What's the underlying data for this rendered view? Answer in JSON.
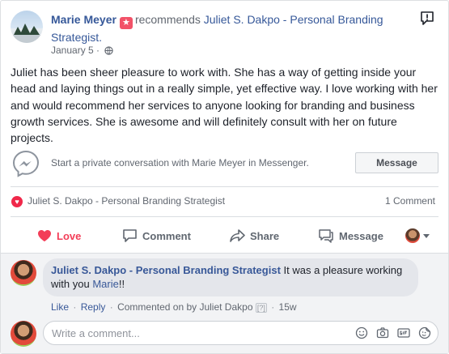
{
  "post": {
    "author": "Marie Meyer",
    "verb": "recommends",
    "page": "Juliet S. Dakpo - Personal Branding Strategist.",
    "date": "January 5",
    "dot": "·",
    "text": "Juliet has been sheer pleasure to work with. She has a way of getting inside your head and laying things out in a really simple, yet effective way. I love working with her and would recommend her services to anyone looking for branding and business growth services. She is awesome and will definitely consult with her on future projects."
  },
  "messenger": {
    "prompt": "Start a private conversation with Marie Meyer in Messenger.",
    "button_label": "Message"
  },
  "reactions": {
    "reactor": "Juliet S. Dakpo - Personal Branding Strategist",
    "comment_count": "1 Comment"
  },
  "actions": {
    "love": "Love",
    "comment": "Comment",
    "share": "Share",
    "message": "Message"
  },
  "comment": {
    "author": "Juliet S. Dakpo - Personal Branding Strategist",
    "text_before": " It was a pleasure working with you ",
    "mention": "Marie",
    "text_after": "!!",
    "like": "Like",
    "reply": "Reply",
    "sep": "·",
    "commented_on_by": "Commented on by Juliet Dakpo",
    "badge": "[?]",
    "time": "15w"
  },
  "composer": {
    "placeholder": "Write a comment..."
  },
  "colors": {
    "link": "#365899",
    "love": "#f33e58",
    "recommend_badge": "#f25268"
  }
}
